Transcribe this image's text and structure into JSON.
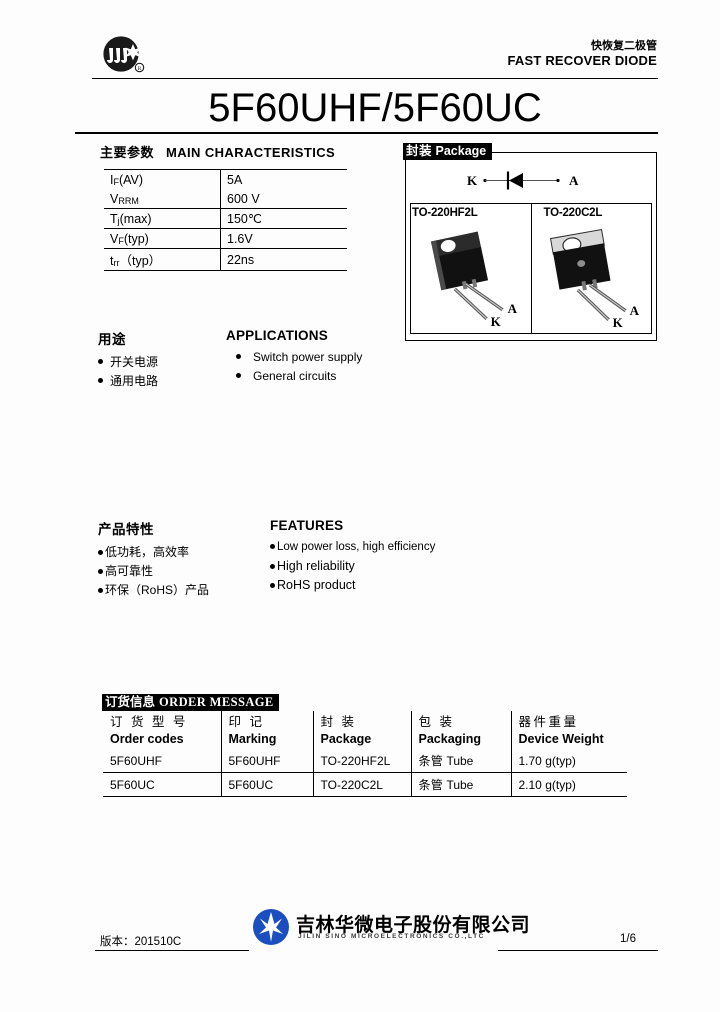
{
  "header": {
    "logo_alt": "jilin-sino-brand-mark",
    "product_type_cn": "快恢复二极管",
    "product_type_en": "FAST RECOVER DIODE",
    "title": "5F60UHF/5F60UC"
  },
  "main_characteristics": {
    "heading_cn": "主要参数",
    "heading_en": "MAIN  CHARACTERISTICS",
    "rows": [
      {
        "param": "IF(AV)",
        "param_base": "I",
        "param_sub": "F",
        "param_rest": "(AV)",
        "value": "5A"
      },
      {
        "param": "VRRM",
        "param_base": "V",
        "param_sub": "RRM",
        "param_rest": "",
        "value": "600 V"
      },
      {
        "param": "Tj(max)",
        "param_base": "T",
        "param_sub": "j",
        "param_rest": "(max)",
        "value": "150℃"
      },
      {
        "param": "VF(typ)",
        "param_base": "V",
        "param_sub": "F",
        "param_rest": "(typ)",
        "value": "1.6V"
      },
      {
        "param": "trr（typ）",
        "param_base": "t",
        "param_sub": "rr",
        "param_rest": "（typ）",
        "value": "22ns"
      }
    ]
  },
  "package": {
    "tag_cn": "封装",
    "tag_en": "Package",
    "symbol": {
      "cathode_label": "K",
      "anode_label": "A"
    },
    "items": [
      {
        "name": "TO-220HF2L",
        "lead_a": "A",
        "lead_k": "K"
      },
      {
        "name": "TO-220C2L",
        "lead_a": "A",
        "lead_k": "K"
      }
    ]
  },
  "applications": {
    "title_cn": "用途",
    "title_en": "APPLICATIONS",
    "items_cn": [
      "开关电源",
      "通用电路"
    ],
    "items_en": [
      "Switch power supply",
      "General circuits"
    ]
  },
  "features": {
    "title_cn": "产品特性",
    "title_en": "FEATURES",
    "items_cn": [
      "低功耗，高效率",
      "高可靠性",
      "环保（RoHS）产品"
    ],
    "items_en": [
      "Low power loss, high efficiency",
      "High reliability",
      "RoHS product"
    ]
  },
  "order_message": {
    "tag_cn": "订货信息",
    "tag_en": "ORDER  MESSAGE",
    "columns": [
      {
        "cn": "订 货 型 号",
        "en": "Order codes"
      },
      {
        "cn": "印    记",
        "en": "Marking"
      },
      {
        "cn": "封    装",
        "en": "Package"
      },
      {
        "cn": "包    装",
        "en": "Packaging"
      },
      {
        "cn": "器件重量",
        "en": "Device Weight"
      }
    ],
    "rows": [
      {
        "order_code": "5F60UHF",
        "marking": "5F60UHF",
        "package": "TO-220HF2L",
        "packaging_cn": "条管",
        "packaging_en": "Tube",
        "weight": "1.70 g(typ)"
      },
      {
        "order_code": "5F60UC",
        "marking": "5F60UC",
        "package": "TO-220C2L",
        "packaging_cn": "条管",
        "packaging_en": "Tube",
        "weight": "2.10 g(typ)"
      }
    ]
  },
  "footer": {
    "version": "版本：201510C",
    "company_cn": "吉林华微电子股份有限公司",
    "company_en": "JILIN  SINO  MICROELECTRONICS   CO.,LTC",
    "page": "1/6",
    "logo_color": "#1b4fbf"
  }
}
